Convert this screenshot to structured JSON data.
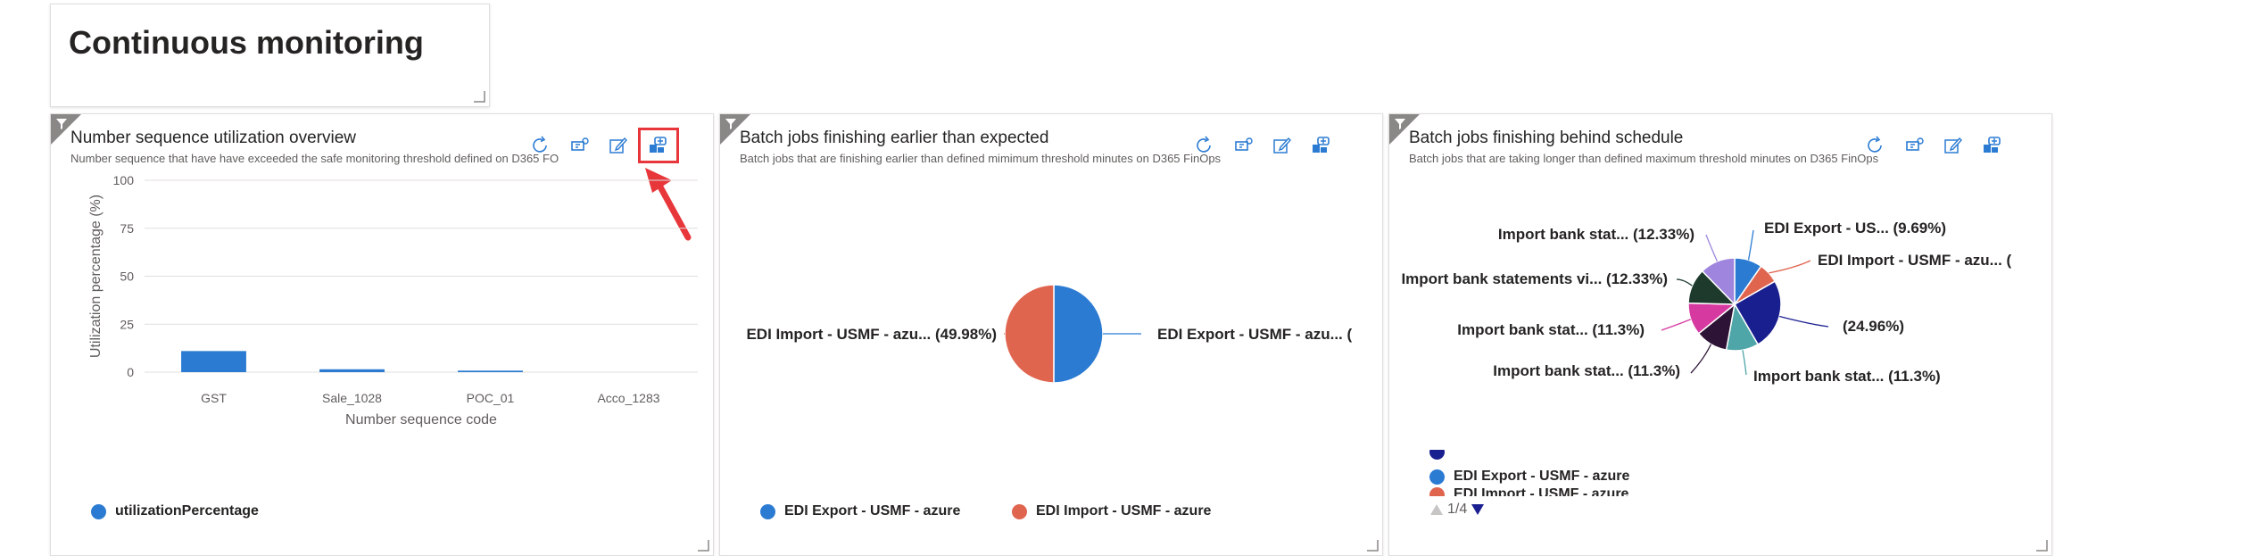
{
  "dashboard": {
    "title": "Continuous monitoring"
  },
  "tile1": {
    "title": "Number sequence utilization overview",
    "subtitle": "Number sequence that have have exceeded the safe monitoring threshold defined on D365 FO",
    "legend": "utilizationPercentage",
    "color": "#2b7bd3",
    "highlight_color": "#e8373b"
  },
  "tile2": {
    "title": "Batch jobs finishing earlier than expected",
    "subtitle": "Batch jobs that are finishing earlier than defined mimimum threshold minutes on D365 FinOps",
    "legend_items": [
      {
        "label": "EDI Export - USMF - azure",
        "color": "#2b7bd3"
      },
      {
        "label": "EDI Import - USMF - azure",
        "color": "#e0654f"
      }
    ]
  },
  "tile3": {
    "title": "Batch jobs finishing behind schedule",
    "subtitle": "Batch jobs that are taking longer than defined maximum threshold minutes on D365 FinOps",
    "legend_items": [
      {
        "label": "EDI Export - USMF - azure",
        "color": "#2b7bd3"
      },
      {
        "label": "EDI Import - USMF - azure",
        "color": "#e0654f"
      }
    ],
    "pager": "1/4"
  },
  "chart_data": [
    {
      "type": "bar",
      "categories": [
        "GST",
        "Sale_1028",
        "POC_01",
        "Acco_1283"
      ],
      "series": [
        {
          "name": "utilizationPercentage",
          "values": [
            11,
            1.5,
            0.8,
            0
          ]
        }
      ],
      "xlabel": "Number sequence code",
      "ylabel": "Utilization percentage (%)",
      "ylim": [
        0,
        100
      ],
      "yticks": [
        "0",
        "25",
        "50",
        "75",
        "100"
      ],
      "grid": true
    },
    {
      "type": "pie",
      "labels": [
        "EDI Export - USMF - azu... (",
        "EDI Import - USMF - azu... (49.98%)"
      ],
      "values": [
        50.02,
        49.98
      ],
      "colors": [
        "#2b7bd3",
        "#e0654f"
      ]
    },
    {
      "type": "pie",
      "labels": [
        "EDI Export - US... (9.69%)",
        "EDI Import - USMF - azu... (",
        "(24.96%)",
        "Import bank stat... (11.3%)",
        "Import bank stat... (11.3%)",
        "Import bank stat... (11.3%)",
        "Import bank statements vi... (12.33%)",
        "Import bank stat... (12.33%)"
      ],
      "values": [
        9.69,
        7.1,
        24.96,
        11.3,
        11.3,
        11.3,
        12.33,
        12.33
      ],
      "colors": [
        "#2b7bd3",
        "#e0654f",
        "#1a1f8f",
        "#4fa6a8",
        "#2d1436",
        "#d63aa0",
        "#1d3a2c",
        "#9f85de"
      ]
    }
  ]
}
